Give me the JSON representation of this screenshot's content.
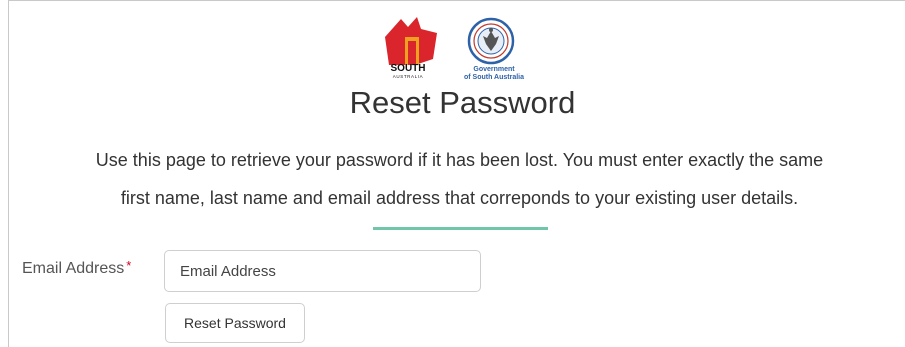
{
  "logos": {
    "sa_logo_text": "SOUTH",
    "sa_logo_subtext": "AUSTRALIA",
    "gov_logo_line1": "Government",
    "gov_logo_line2": "of South Australia",
    "sa_red": "#d9252b",
    "sa_orange": "#f0a020",
    "gov_blue": "#2e62a8"
  },
  "page": {
    "title": "Reset Password",
    "intro_line1": "Use this page to retrieve your password if it has been lost. You must enter exactly the same",
    "intro_line2": "first name, last name and email address that correponds to your existing user details.",
    "divider_color": "#72c6a8"
  },
  "form": {
    "email_label": "Email Address",
    "required_marker": "*",
    "email_placeholder": "Email Address",
    "email_value": "",
    "submit_label": "Reset Password"
  }
}
